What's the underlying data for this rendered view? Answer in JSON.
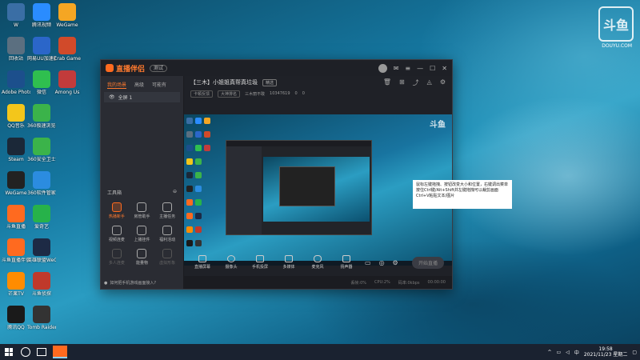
{
  "desktop_icons": [
    {
      "label": "W",
      "color": "#3a6ea5"
    },
    {
      "label": "腾讯视频",
      "color": "#2a8cff"
    },
    {
      "label": "WeGame",
      "color": "#f5a623"
    },
    {
      "label": "回收站",
      "color": "#5b6f80"
    },
    {
      "label": "网易UU加速器",
      "color": "#2b66c9"
    },
    {
      "label": "Crab Game",
      "color": "#d14a2a"
    },
    {
      "label": "Adobe Photosh...",
      "color": "#1c4f8c"
    },
    {
      "label": "微信",
      "color": "#2fbf4f"
    },
    {
      "label": "Among Us",
      "color": "#c23b3b"
    },
    {
      "label": "QQ音乐",
      "color": "#f3c61b"
    },
    {
      "label": "360极速浏览器X",
      "color": "#3bb34a"
    },
    {
      "label": "",
      "color": "transparent"
    },
    {
      "label": "Steam",
      "color": "#1b2838"
    },
    {
      "label": "360安全卫士",
      "color": "#3bb34a"
    },
    {
      "label": "",
      "color": "transparent"
    },
    {
      "label": "WeGame",
      "color": "#222222"
    },
    {
      "label": "360软件管家",
      "color": "#2b8ce0"
    },
    {
      "label": "",
      "color": "transparent"
    },
    {
      "label": "斗鱼直播",
      "color": "#ff6a1f"
    },
    {
      "label": "爱奇艺",
      "color": "#27b24a"
    },
    {
      "label": "",
      "color": "transparent"
    },
    {
      "label": "斗鱼直播伴侣",
      "color": "#ff6a1f"
    },
    {
      "label": "英雄联盟WeGame版",
      "color": "#1d2a45"
    },
    {
      "label": "",
      "color": "transparent"
    },
    {
      "label": "芒果TV",
      "color": "#ff8c00"
    },
    {
      "label": "斗鱼侦探",
      "color": "#c0392b"
    },
    {
      "label": "",
      "color": "transparent"
    },
    {
      "label": "腾讯QQ",
      "color": "#1a1a1a"
    },
    {
      "label": "Tomb Raider",
      "color": "#333333"
    }
  ],
  "corner_logo": {
    "text": "斗鱼",
    "caption": "DOUYU.COM"
  },
  "app": {
    "brand": "直播伴侣",
    "beta": "测试",
    "title_icons": [
      "avatar-icon",
      "mail-icon",
      "menu-icon",
      "minimize-icon",
      "maximize-icon",
      "close-icon"
    ],
    "side_tabs": [
      "我的场景",
      "高级",
      "可能有"
    ],
    "scene": "全屏 1",
    "tools_title": "工具箱",
    "tools": [
      {
        "label": "热播新手",
        "style": "hot"
      },
      {
        "label": "房管助手",
        "style": ""
      },
      {
        "label": "主播任务",
        "style": ""
      },
      {
        "label": "视频连麦",
        "style": ""
      },
      {
        "label": "上播挂件",
        "style": ""
      },
      {
        "label": "福利活动",
        "style": ""
      },
      {
        "label": "多人连麦",
        "style": "dim"
      },
      {
        "label": "能量物",
        "style": ""
      },
      {
        "label": "虚拟形象",
        "style": "dim"
      }
    ],
    "side_tip": "如何把手机游戏画面接入?",
    "stream_title": "【三木】小姐姐真帮真垃圾",
    "stream_tag": "精选",
    "sub_info": [
      "卡顿反馈",
      "大神排名",
      "三木丽不敢",
      "10347619",
      "0",
      "0"
    ],
    "head_icons": [
      "trash-icon",
      "gift-icon",
      "share-icon",
      "bell-icon",
      "settings-icon"
    ],
    "bottom_items": [
      "直播屏幕",
      "摄像头",
      "手机投屏",
      "多媒体",
      "麦克风",
      "扬声器"
    ],
    "go_live": "开始直播",
    "status_items": [
      "丢帧:0%",
      "CPU:2%",
      "码率:0kbps",
      "00:00:00"
    ],
    "preview_logo": "斗鱼"
  },
  "tooltip": {
    "text": "鼠标左键拖拽、按钮改变大小和位置，右键调出菜单 按住Ctrl键/Alt+Shift并左键拖拽可以裁剪画面 Ctrl+V粘贴文本/图片"
  },
  "taskbar": {
    "time": "19:58",
    "date": "2021/11/23 星期二"
  }
}
